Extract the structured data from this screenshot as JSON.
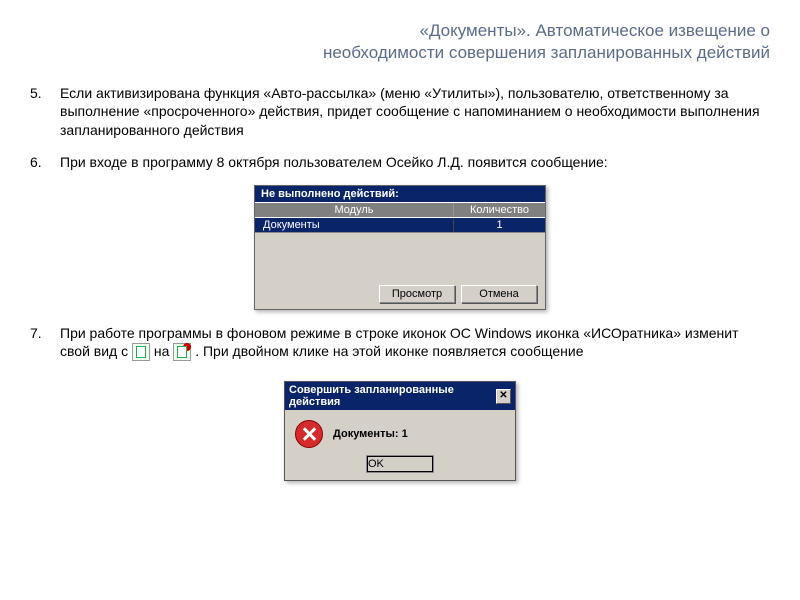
{
  "header": {
    "line1": "«Документы». Автоматическое извещение о",
    "line2": "необходимости совершения запланированных действий"
  },
  "items": [
    {
      "num": "5.",
      "text": "Если активизирована функция «Авто-рассылка» (меню «Утилиты»), пользователю, ответственному за выполнение «просроченного» действия, придет сообщение с напоминанием о необходимости выполнения запланированного действия"
    },
    {
      "num": "6.",
      "text": "При входе в программу 8 октября пользователем Осейко Л.Д. появится сообщение:"
    },
    {
      "num": "7.",
      "text_before": "При работе программы в фоновом режиме в строке иконок ОС Windows иконка «ИСОратника» изменит свой вид с ",
      "text_mid": " на ",
      "text_after": ". При двойном клике на этой иконке появляется сообщение"
    }
  ],
  "dialog1": {
    "title": "Не выполнено действий:",
    "col1": "Модуль",
    "col2": "Количество",
    "row_module": "Документы",
    "row_count": "1",
    "btn_view": "Просмотр",
    "btn_cancel": "Отмена"
  },
  "dialog2": {
    "title": "Совершить запланированные действия",
    "message": "Документы: 1",
    "btn_ok": "OK"
  }
}
